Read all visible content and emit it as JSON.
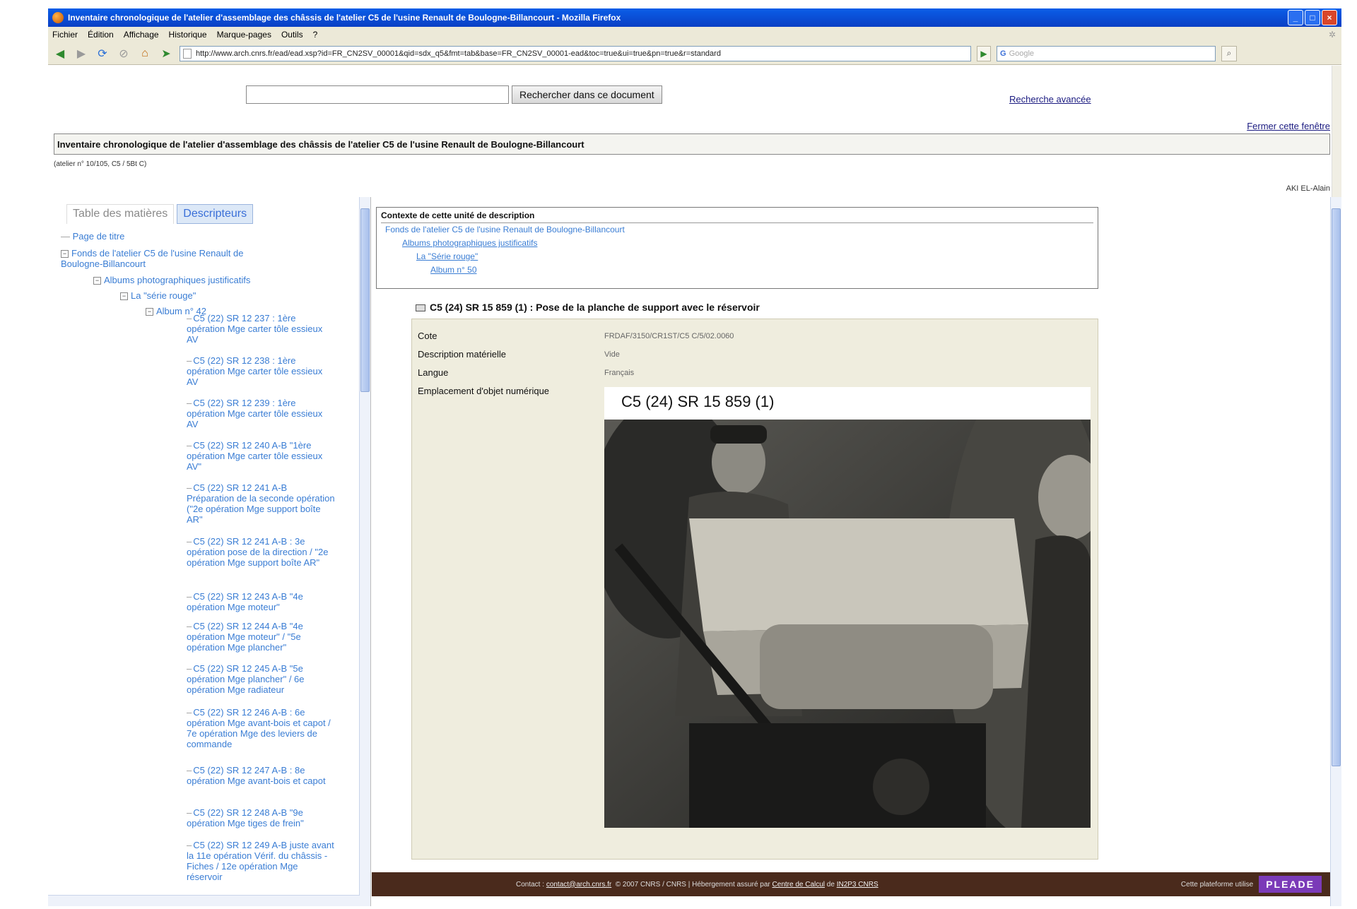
{
  "browser": {
    "window_title": "Inventaire chronologique de l'atelier d'assemblage des châssis de l'atelier C5 de l'usine Renault de Boulogne-Billancourt - Mozilla Firefox",
    "menu": [
      "Fichier",
      "Édition",
      "Affichage",
      "Historique",
      "Marque-pages",
      "Outils",
      "?"
    ],
    "url": "http://www.arch.cnrs.fr/ead/ead.xsp?id=FR_CN2SV_00001&qid=sdx_q5&fmt=tab&base=FR_CN2SV_00001-ead&toc=true&ui=true&pn=true&r=standard",
    "search_engine_placeholder": "Google"
  },
  "page": {
    "search_input_value": "",
    "search_button": "Rechercher dans ce document",
    "advanced_search": "Recherche avancée",
    "close_window": "Fermer cette fenêtre",
    "document_title": "Inventaire chronologique de l'atelier d'assemblage des châssis de l'atelier C5 de l'usine Renault de Boulogne-Billancourt",
    "document_subtitle": "(atelier n° 10/105, C5 / 5Bt C)",
    "author": "AKI EL-Alain"
  },
  "left_panel": {
    "tabs": [
      "Table des matières",
      "Descripteurs"
    ],
    "tree": {
      "root": "Page de titre",
      "fonds": "Fonds de l'atelier C5 de l'usine Renault de Boulogne-Billancourt",
      "series": "Albums photographiques justificatifs",
      "subseries": "La \"série rouge\"",
      "album": "Album n° 42"
    },
    "items": [
      "C5 (22) SR 12 237 : 1ère opération Mge carter tôle essieux AV",
      "C5 (22) SR 12 238 : 1ère opération Mge carter tôle essieux AV",
      "C5 (22) SR 12 239 : 1ère opération Mge carter tôle essieux AV",
      "C5 (22) SR 12 240 A-B \"1ère opération Mge carter tôle essieux AV\"",
      "C5 (22) SR 12 241 A-B Préparation de la seconde opération (\"2e opération Mge support boîte AR\"",
      "C5 (22) SR 12 241 A-B : 3e opération pose de la direction / \"2e opération Mge support boîte AR\"",
      "C5 (22) SR 12 243 A-B \"4e opération Mge moteur\"",
      "C5 (22) SR 12 244 A-B \"4e opération Mge moteur\" / \"5e opération Mge plancher\"",
      "C5 (22) SR 12 245 A-B \"5e opération Mge plancher\" / 6e opération Mge radiateur",
      "C5 (22) SR 12 246 A-B : 6e opération Mge avant-bois et capot / 7e opération Mge des leviers de commande",
      "C5 (22) SR 12 247 A-B : 8e opération Mge avant-bois et capot",
      "C5 (22) SR 12 248 A-B \"9e opération Mge tiges de frein\"",
      "C5 (22) SR 12 249 A-B juste avant la 11e opération Vérif. du châssis - Fiches / 12e opération Mge réservoir"
    ]
  },
  "right_panel": {
    "contents_heading": "Contexte de cette unité de description",
    "crumbs": [
      "Fonds de l'atelier C5 de l'usine Renault de Boulogne-Billancourt",
      "Albums photographiques justificatifs",
      "La \"Série rouge\"",
      "Album n° 50"
    ],
    "unit_title": "C5 (24) SR 15 859 (1) : Pose de la planche de support avec le réservoir",
    "fields": [
      {
        "label": "Cote",
        "value": "FRDAF/3150/CR1ST/C5 C/5/02.0060"
      },
      {
        "label": "Description matérielle",
        "value": "Vide"
      },
      {
        "label": "Langue",
        "value": "Français"
      },
      {
        "label": "Emplacement d'objet numérique",
        "value": ""
      }
    ],
    "image_caption": "C5 (24) SR 15 859 (1)"
  },
  "footer": {
    "contact_label": "Contact :",
    "contact_email": "contact@arch.cnrs.fr",
    "copyright": "© 2007 CNRS / CNRS",
    "hosting": "| Hébergement assuré par",
    "host_1": "Centre de Calcul",
    "host_sep": "de",
    "host_2": "IN2P3 CNRS",
    "platform": "Cette plateforme utilise",
    "logo": "PLEADE"
  },
  "colors": {
    "title_bar": "#0a4fd6",
    "link": "#3a7dd4",
    "footer_bg": "#4a2a1c",
    "description_bg": "#efedde",
    "pleade": "#7b3ab8"
  }
}
